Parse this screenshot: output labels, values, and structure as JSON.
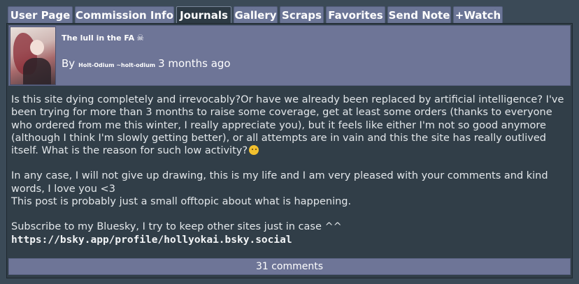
{
  "tabs": [
    "User Page",
    "Commission Info",
    "Journals",
    "Gallery",
    "Scraps",
    "Favorites",
    "Send Note",
    "+Watch"
  ],
  "active_tab": "Journals",
  "journal": {
    "title": "The lull in the FA",
    "title_icon": "skull-crossbones-icon",
    "by_label": "By",
    "author": "Holt-Odium ~holt-odium",
    "time": "3 months ago"
  },
  "body": {
    "p1": "Is this site dying completely and irrevocably?Or have we already been replaced by artificial intelligence? I've been trying for more than 3 months to raise some coverage, get at least some orders (thanks to everyone who ordered from me this winter, I really appreciate you), but it feels like either I'm not so good anymore (although I think I'm slowly getting better), or all attempts are in vain and this the site has really outlived itself. What is the reason for such low activity?",
    "p1_emoji": "thinking-face-icon",
    "p2": "In any case, I will not give up drawing, this is my life and I am very pleased with your comments and kind words, I love you <3",
    "p3": "This post is probably just a small offtopic about what is happening.",
    "p4": "Subscribe to my Bluesky, I try to keep other sites just in case ^^",
    "link": "https://bsky.app/profile/hollyokai.bsky.social"
  },
  "comments_label": "31 comments",
  "colors": {
    "page_bg": "#3b4a57",
    "tab_bg": "#6b7596",
    "active_tab_bg": "#2d3a44",
    "header_bg": "#6e7597",
    "content_bg": "#313e48"
  }
}
